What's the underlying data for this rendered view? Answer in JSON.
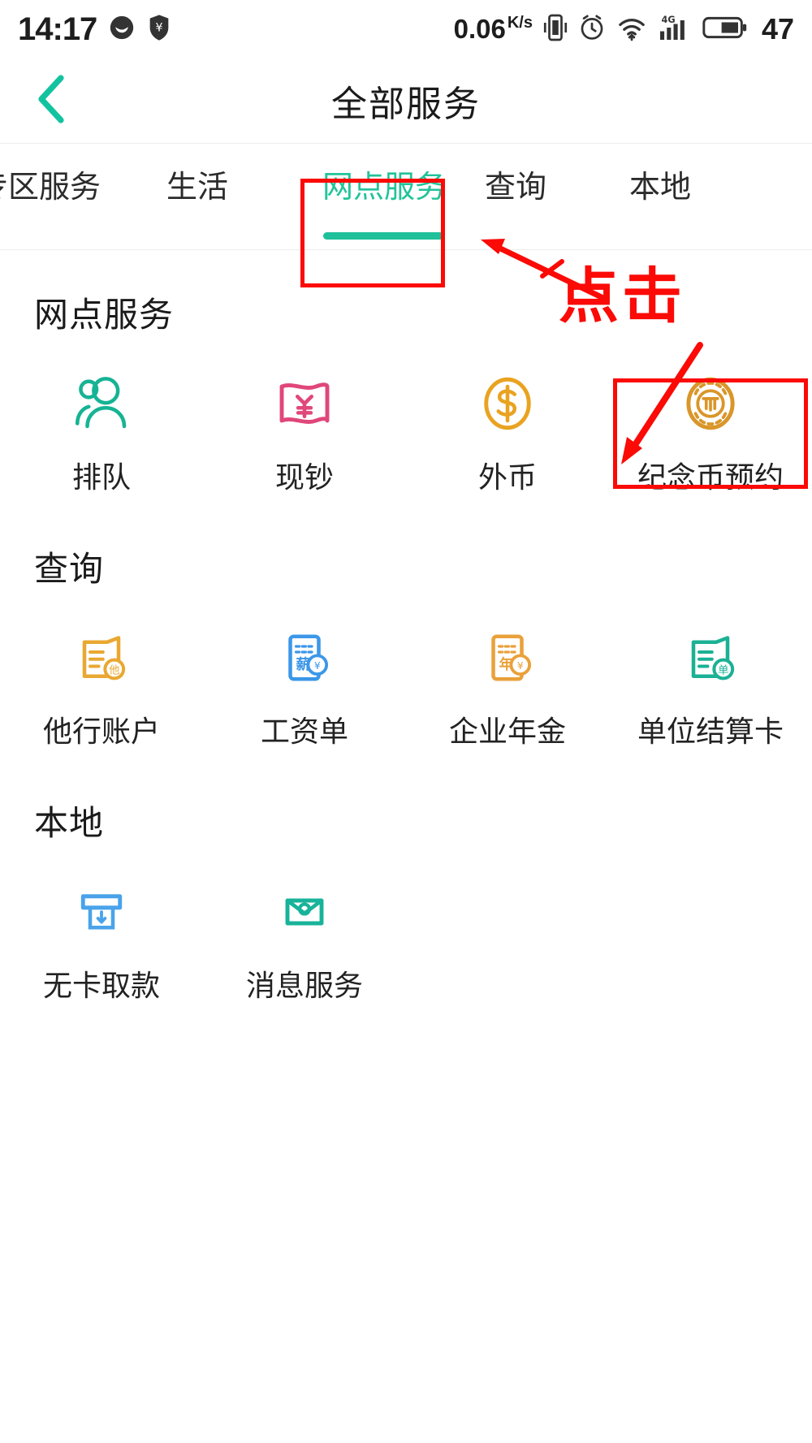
{
  "status_bar": {
    "time": "14:17",
    "icons_left": [
      "messenger-icon",
      "shield-icon"
    ],
    "net_speed": "0.06",
    "net_speed_unit": "K/s",
    "icons_right": [
      "vibrate-icon",
      "alarm-icon",
      "wifi-icon",
      "signal-4g-icon",
      "battery-icon"
    ],
    "signal_label": "4G",
    "battery_level": "47"
  },
  "header": {
    "back_icon": "chevron-left-icon",
    "title": "全部服务"
  },
  "tabs": [
    {
      "label": "专区服务",
      "active": false
    },
    {
      "label": "生活",
      "active": false
    },
    {
      "label": "网点服务",
      "active": true
    },
    {
      "label": "查询",
      "active": false
    },
    {
      "label": "本地",
      "active": false
    }
  ],
  "sections": [
    {
      "title": "网点服务",
      "items": [
        {
          "label": "排队",
          "icon": "queue-people-icon",
          "color": "#16b394"
        },
        {
          "label": "现钞",
          "icon": "banknote-yuan-icon",
          "color": "#e0477b"
        },
        {
          "label": "外币",
          "icon": "dollar-coin-icon",
          "color": "#e9a321"
        },
        {
          "label": "纪念币预约",
          "icon": "commemorative-coin-icon",
          "color": "#d9962a"
        }
      ]
    },
    {
      "title": "查询",
      "items": [
        {
          "label": "他行账户",
          "icon": "other-bank-card-icon",
          "color": "#e9a832"
        },
        {
          "label": "工资单",
          "icon": "payslip-icon",
          "color": "#3c97e8"
        },
        {
          "label": "企业年金",
          "icon": "annuity-doc-icon",
          "color": "#e9a13a"
        },
        {
          "label": "单位结算卡",
          "icon": "settlement-card-icon",
          "color": "#1bb195"
        }
      ]
    },
    {
      "title": "本地",
      "items": [
        {
          "label": "无卡取款",
          "icon": "cardless-withdraw-icon",
          "color": "#4aa3ea"
        },
        {
          "label": "消息服务",
          "icon": "message-envelope-icon",
          "color": "#17b39a"
        }
      ]
    }
  ],
  "annotations": {
    "click_text": "点击",
    "highlight_color": "#fb0a06",
    "boxes": [
      "tab-网点服务",
      "item-纪念币预约"
    ],
    "arrows": [
      "arrow-to-tab",
      "arrow-to-coin-item"
    ]
  },
  "theme": {
    "accent": "#1fc09a",
    "text": "#1a1a1a",
    "annotation": "#fb0a06"
  }
}
